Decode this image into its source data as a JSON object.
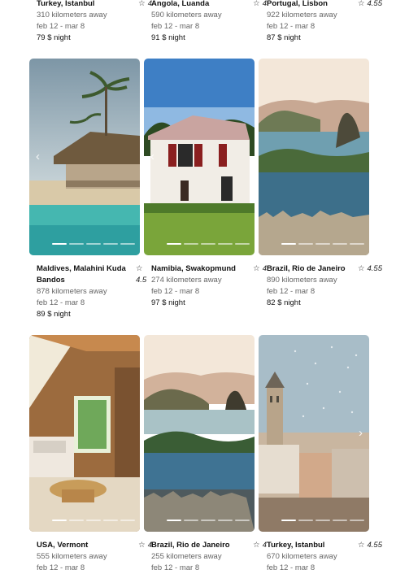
{
  "listings": [
    {
      "location": "Turkey, Istanbul",
      "distance": "310 kilometers away",
      "dates": "feb 12 - mar 8",
      "price": "79 $ night",
      "rating": "4"
    },
    {
      "location": "Angola, Luanda",
      "distance": "590 kilometers away",
      "dates": "feb 12 - mar 8",
      "price": "91 $ night",
      "rating": "4"
    },
    {
      "location": "Portugal, Lisbon",
      "distance": "922 kilometers away",
      "dates": "feb 12 - mar 8",
      "price": "87 $ night",
      "rating": "4.55"
    },
    {
      "location": "Maldives, Malahini Kuda Bandos",
      "distance": "878 kilometers away",
      "dates": "feb 12 - mar 8",
      "price": "89 $ night",
      "rating": "4.5"
    },
    {
      "location": "Namibia, Swakopmund",
      "distance": "274 kilometers away",
      "dates": "feb 12 - mar 8",
      "price": "97 $ night",
      "rating": "4"
    },
    {
      "location": "Brazil, Rio de Janeiro",
      "distance": "890 kilometers away",
      "dates": "feb 12 - mar 8",
      "price": "82 $ night",
      "rating": "4.55"
    },
    {
      "location": "USA, Vermont",
      "distance": "555 kilometers away",
      "dates": "feb 12 - mar 8",
      "price": "",
      "rating": "4"
    },
    {
      "location": "Brazil, Rio de Janeiro",
      "distance": "255 kilometers away",
      "dates": "feb 12 - mar 8",
      "price": "",
      "rating": "4"
    },
    {
      "location": "Turkey, Istanbul",
      "distance": "670 kilometers away",
      "dates": "feb 12 - mar 8",
      "price": "",
      "rating": "4.55"
    }
  ],
  "icons": {
    "star": "star-outline-icon",
    "prev": "chevron-left-icon",
    "next": "chevron-right-icon"
  },
  "colors": {
    "text": "#111111",
    "muted": "#666666"
  }
}
